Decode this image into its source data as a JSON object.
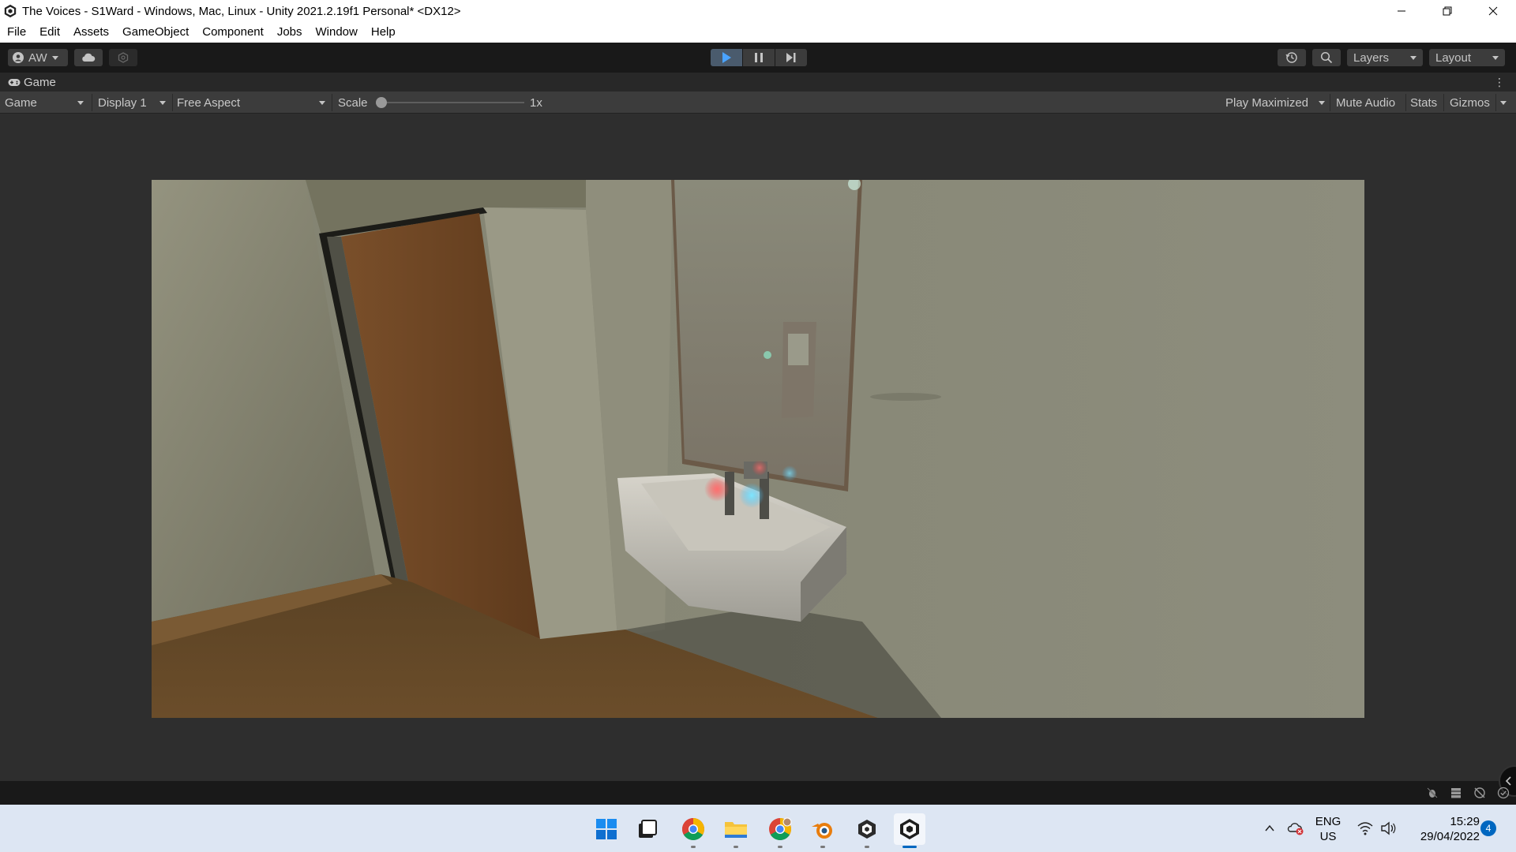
{
  "window": {
    "title": "The Voices - S1Ward - Windows, Mac, Linux - Unity 2021.2.19f1 Personal* <DX12>",
    "controls": [
      "minimize-icon",
      "restore-icon",
      "close-icon"
    ]
  },
  "menu": {
    "items": [
      "File",
      "Edit",
      "Assets",
      "GameObject",
      "Component",
      "Jobs",
      "Window",
      "Help"
    ]
  },
  "toolbar": {
    "account_label": "AW",
    "layers_label": "Layers",
    "layout_label": "Layout",
    "play_state": "playing"
  },
  "game_tab": {
    "tab_label": "Game",
    "view_select": "Game",
    "display_select": "Display 1",
    "aspect_select": "Free Aspect",
    "scale_label": "Scale",
    "scale_value": "1x",
    "play_maximized": "Play Maximized",
    "mute_audio": "Mute Audio",
    "stats": "Stats",
    "gizmos": "Gizmos"
  },
  "taskbar": {
    "apps": [
      "windows-start-icon",
      "task-view-icon",
      "chrome-icon",
      "file-explorer-icon",
      "chrome-profile-icon",
      "blender-icon",
      "unity-hub-icon",
      "unity-editor-icon"
    ],
    "lang_primary": "ENG",
    "lang_secondary": "US",
    "time": "15:29",
    "date": "29/04/2022",
    "notification_count": "4"
  },
  "colors": {
    "accent": "#0067c0",
    "play_active": "#4a5b6d",
    "editor_bg": "#2e2e2e"
  }
}
